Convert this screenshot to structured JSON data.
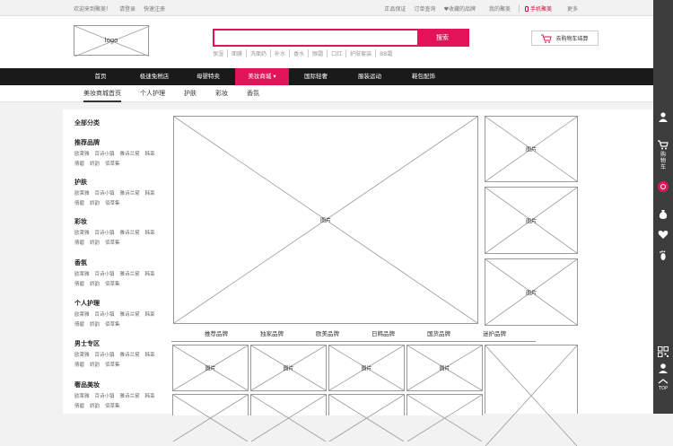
{
  "topbar": {
    "welcome": "欢迎来到聚美！",
    "login": "请登录",
    "register": "快速注册",
    "links": [
      "正品保证",
      "订单查询",
      "♥收藏的品牌",
      "我的聚美"
    ],
    "mobile": "手机聚美",
    "more": "更多"
  },
  "header": {
    "logo_text": "logo",
    "search_placeholder": "",
    "search_button": "搜索",
    "hotwords": [
      "保湿",
      "面膜",
      "洗面奶",
      "补水",
      "香水",
      "眼霜",
      "口红",
      "护肤套装",
      "BB霜"
    ],
    "cart_button": "去购物车结算"
  },
  "nav": {
    "items": [
      "首页",
      "极速免税店",
      "母婴特卖",
      "美妆商城",
      "国际轻奢",
      "服装运动",
      "鞋包配饰"
    ],
    "active_index": 3
  },
  "subnav": {
    "items": [
      "美妆商城首页",
      "个人护理",
      "护肤",
      "彩妆",
      "香氛"
    ]
  },
  "sidebar": {
    "title": "全部分类",
    "categories": [
      {
        "name": "推荐品牌",
        "row1": [
          "欧莱雅",
          "百诗小镇",
          "雅诗兰黛",
          "韩束"
        ],
        "row2": [
          "倩碧",
          "娇韵",
          "佰草集"
        ]
      },
      {
        "name": "护肤",
        "row1": [
          "欧莱雅",
          "百诗小镇",
          "雅诗兰黛",
          "韩束"
        ],
        "row2": [
          "倩碧",
          "娇韵",
          "佰草集"
        ]
      },
      {
        "name": "彩妆",
        "row1": [
          "欧莱雅",
          "百诗小镇",
          "雅诗兰黛",
          "韩束"
        ],
        "row2": [
          "倩碧",
          "娇韵",
          "佰草集"
        ]
      },
      {
        "name": "香氛",
        "row1": [
          "欧莱雅",
          "百诗小镇",
          "雅诗兰黛",
          "韩束"
        ],
        "row2": [
          "倩碧",
          "娇韵",
          "佰草集"
        ]
      },
      {
        "name": "个人护理",
        "row1": [
          "欧莱雅",
          "百诗小镇",
          "雅诗兰黛",
          "韩束"
        ],
        "row2": [
          "倩碧",
          "娇韵",
          "佰草集"
        ]
      },
      {
        "name": "男士专区",
        "row1": [
          "欧莱雅",
          "百诗小镇",
          "雅诗兰黛",
          "韩束"
        ],
        "row2": [
          "倩碧",
          "娇韵",
          "佰草集"
        ]
      },
      {
        "name": "奢品美妆",
        "row1": [
          "欧莱雅",
          "百诗小镇",
          "雅诗兰黛",
          "韩束"
        ],
        "row2": [
          "倩碧",
          "娇韵",
          "佰草集"
        ]
      }
    ]
  },
  "placeholder_label": "图片",
  "brandtabs": [
    "推荐品牌",
    "独家品牌",
    "欧美品牌",
    "日韩品牌",
    "国货品牌",
    "迷护品牌"
  ],
  "toolbar": {
    "cart_label": [
      "购",
      "物",
      "车"
    ],
    "top_label": "TOP"
  }
}
